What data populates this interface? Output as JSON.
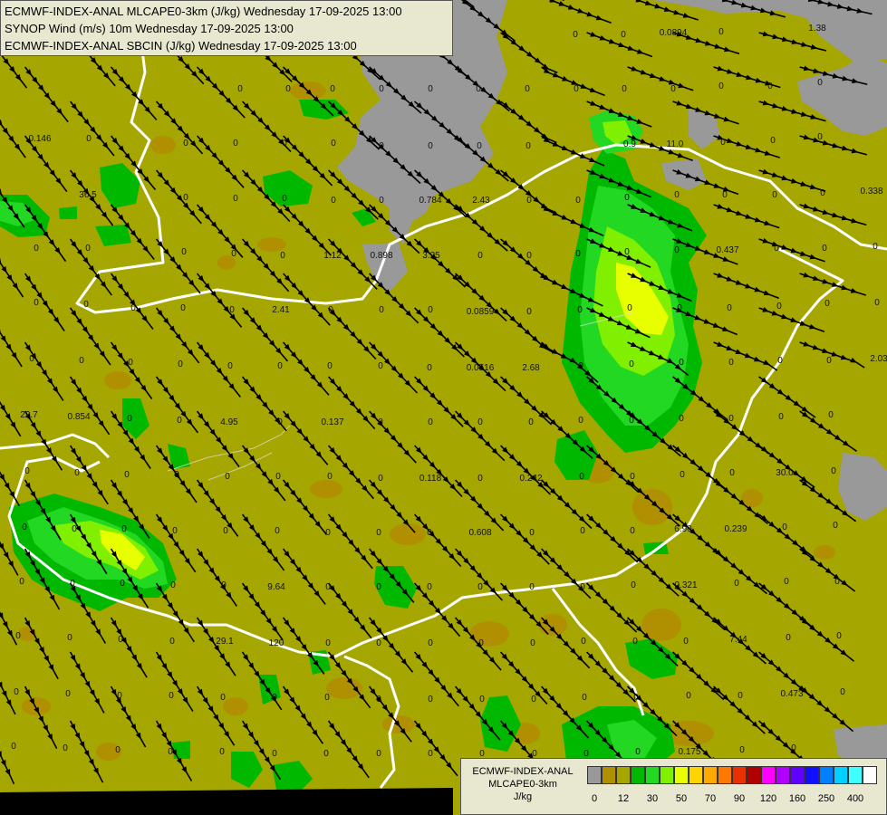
{
  "header": {
    "lines": [
      "ECMWF-INDEX-ANAL MLCAPE0-3km (J/kg) Wednesday 17-09-2025 13:00",
      "SYNOP Wind (m/s) 10m Wednesday 17-09-2025 13:00",
      "ECMWF-INDEX-ANAL SBCIN (J/kg) Wednesday 17-09-2025 13:00"
    ]
  },
  "legend": {
    "name_lines": [
      "ECMWF-INDEX-ANAL",
      "MLCAPE0-3km",
      "J/kg"
    ],
    "colors": [
      "#999999",
      "#b09000",
      "#a6a600",
      "#00b800",
      "#22d822",
      "#80f000",
      "#e8ff00",
      "#ffd400",
      "#ffa800",
      "#ff7800",
      "#e83000",
      "#b00000",
      "#ff00ff",
      "#b000ff",
      "#6000ff",
      "#1010ff",
      "#0080ff",
      "#00d0ff",
      "#40ffff",
      "#ffffff"
    ],
    "ticks": [
      "0",
      "12",
      "30",
      "50",
      "70",
      "90",
      "120",
      "160",
      "250",
      "400"
    ],
    "tick_colors_index": [
      1,
      3,
      5,
      7,
      9,
      11,
      13,
      15,
      17,
      19
    ]
  },
  "map_values": [
    {
      "t": "0",
      "a": [
        163,
        37
      ]
    },
    {
      "t": "0",
      "a": [
        240,
        37
      ]
    },
    {
      "t": "0",
      "a": [
        318,
        37
      ]
    },
    {
      "t": "0",
      "a": [
        398,
        37
      ]
    },
    {
      "t": "0",
      "a": [
        475,
        37
      ]
    },
    {
      "t": "0",
      "a": [
        635,
        37
      ]
    },
    {
      "t": "0",
      "a": [
        688,
        37
      ]
    },
    {
      "t": "0.0894",
      "a": [
        743,
        35
      ]
    },
    {
      "t": "0",
      "a": [
        796,
        34
      ]
    },
    {
      "t": "1.38",
      "a": [
        902,
        30
      ]
    },
    {
      "t": "0",
      "a": [
        265,
        97
      ]
    },
    {
      "t": "0",
      "a": [
        318,
        97
      ]
    },
    {
      "t": "0",
      "a": [
        367,
        97
      ]
    },
    {
      "t": "0",
      "a": [
        421,
        97
      ]
    },
    {
      "t": "0",
      "a": [
        475,
        97
      ]
    },
    {
      "t": "0",
      "a": [
        528,
        97
      ]
    },
    {
      "t": "0",
      "a": [
        582,
        97
      ]
    },
    {
      "t": "0",
      "a": [
        636,
        97
      ]
    },
    {
      "t": "0",
      "a": [
        689,
        97
      ]
    },
    {
      "t": "0",
      "a": [
        743,
        97
      ]
    },
    {
      "t": "0",
      "a": [
        796,
        94
      ]
    },
    {
      "t": "0",
      "a": [
        850,
        94
      ]
    },
    {
      "t": "0",
      "a": [
        905,
        90
      ]
    },
    {
      "t": "0.146",
      "a": [
        44,
        152
      ]
    },
    {
      "t": "0",
      "a": [
        98,
        152
      ]
    },
    {
      "t": "0",
      "a": [
        205,
        157
      ]
    },
    {
      "t": "0",
      "a": [
        260,
        157
      ]
    },
    {
      "t": "0",
      "a": [
        314,
        157
      ]
    },
    {
      "t": "0",
      "a": [
        368,
        157
      ]
    },
    {
      "t": "0",
      "a": [
        421,
        160
      ]
    },
    {
      "t": "0",
      "a": [
        475,
        160
      ]
    },
    {
      "t": "0",
      "a": [
        529,
        160
      ]
    },
    {
      "t": "0",
      "a": [
        583,
        160
      ]
    },
    {
      "t": "0.9",
      "a": [
        695,
        158
      ]
    },
    {
      "t": "11.0",
      "a": [
        745,
        158
      ]
    },
    {
      "t": "0",
      "a": [
        798,
        156
      ]
    },
    {
      "t": "0",
      "a": [
        853,
        154
      ]
    },
    {
      "t": "0",
      "a": [
        905,
        150
      ]
    },
    {
      "t": "36.5",
      "a": [
        97,
        214
      ]
    },
    {
      "t": "0",
      "a": [
        205,
        217
      ]
    },
    {
      "t": "0",
      "a": [
        260,
        218
      ]
    },
    {
      "t": "0",
      "a": [
        314,
        218
      ]
    },
    {
      "t": "0",
      "a": [
        368,
        220
      ]
    },
    {
      "t": "0",
      "a": [
        421,
        220
      ]
    },
    {
      "t": "0.784",
      "a": [
        475,
        220
      ]
    },
    {
      "t": "2.43",
      "a": [
        531,
        220
      ]
    },
    {
      "t": "0",
      "a": [
        584,
        220
      ]
    },
    {
      "t": "0",
      "a": [
        638,
        220
      ]
    },
    {
      "t": "0",
      "a": [
        692,
        217
      ]
    },
    {
      "t": "0",
      "a": [
        747,
        214
      ]
    },
    {
      "t": "0",
      "a": [
        800,
        214
      ]
    },
    {
      "t": "0",
      "a": [
        855,
        214
      ]
    },
    {
      "t": "0",
      "a": [
        908,
        212
      ]
    },
    {
      "t": "0.338",
      "a": [
        962,
        210
      ]
    },
    {
      "t": "0",
      "a": [
        40,
        273
      ]
    },
    {
      "t": "0",
      "a": [
        97,
        273
      ]
    },
    {
      "t": "0",
      "a": [
        203,
        277
      ]
    },
    {
      "t": "0",
      "a": [
        258,
        279
      ]
    },
    {
      "t": "0",
      "a": [
        312,
        281
      ]
    },
    {
      "t": "1.12",
      "a": [
        367,
        281
      ]
    },
    {
      "t": "0.898",
      "a": [
        421,
        281
      ]
    },
    {
      "t": "3.25",
      "a": [
        476,
        281
      ]
    },
    {
      "t": "0",
      "a": [
        530,
        281
      ]
    },
    {
      "t": "0",
      "a": [
        584,
        281
      ]
    },
    {
      "t": "0",
      "a": [
        638,
        279
      ]
    },
    {
      "t": "0",
      "a": [
        692,
        277
      ]
    },
    {
      "t": "0",
      "a": [
        747,
        275
      ]
    },
    {
      "t": "0.437",
      "a": [
        803,
        275
      ]
    },
    {
      "t": "0",
      "a": [
        857,
        273
      ]
    },
    {
      "t": "0",
      "a": [
        910,
        273
      ]
    },
    {
      "t": "0",
      "a": [
        966,
        271
      ]
    },
    {
      "t": "0",
      "a": [
        40,
        333
      ]
    },
    {
      "t": "0",
      "a": [
        95,
        335
      ]
    },
    {
      "t": "0",
      "a": [
        147,
        339
      ]
    },
    {
      "t": "0",
      "a": [
        202,
        339
      ]
    },
    {
      "t": "0",
      "a": [
        256,
        341
      ]
    },
    {
      "t": "2.41",
      "a": [
        310,
        341
      ]
    },
    {
      "t": "0",
      "a": [
        365,
        341
      ]
    },
    {
      "t": "0",
      "a": [
        421,
        341
      ]
    },
    {
      "t": "0",
      "a": [
        475,
        341
      ]
    },
    {
      "t": "0.0859",
      "a": [
        530,
        343
      ]
    },
    {
      "t": "0",
      "a": [
        584,
        343
      ]
    },
    {
      "t": "0",
      "a": [
        640,
        341
      ]
    },
    {
      "t": "0",
      "a": [
        695,
        339
      ]
    },
    {
      "t": "0",
      "a": [
        750,
        339
      ]
    },
    {
      "t": "0",
      "a": [
        805,
        339
      ]
    },
    {
      "t": "0",
      "a": [
        860,
        337
      ]
    },
    {
      "t": "0",
      "a": [
        913,
        334
      ]
    },
    {
      "t": "0",
      "a": [
        968,
        333
      ]
    },
    {
      "t": "0",
      "a": [
        35,
        395
      ]
    },
    {
      "t": "0",
      "a": [
        90,
        397
      ]
    },
    {
      "t": "0",
      "a": [
        144,
        399
      ]
    },
    {
      "t": "0",
      "a": [
        199,
        401
      ]
    },
    {
      "t": "0",
      "a": [
        254,
        403
      ]
    },
    {
      "t": "0",
      "a": [
        309,
        403
      ]
    },
    {
      "t": "0",
      "a": [
        364,
        403
      ]
    },
    {
      "t": "0",
      "a": [
        420,
        403
      ]
    },
    {
      "t": "0",
      "a": [
        474,
        405
      ]
    },
    {
      "t": "0.0516",
      "a": [
        530,
        405
      ]
    },
    {
      "t": "2.68",
      "a": [
        586,
        405
      ]
    },
    {
      "t": "0",
      "a": [
        641,
        403
      ]
    },
    {
      "t": "0",
      "a": [
        697,
        401
      ]
    },
    {
      "t": "0",
      "a": [
        752,
        399
      ]
    },
    {
      "t": "0",
      "a": [
        807,
        399
      ]
    },
    {
      "t": "0",
      "a": [
        861,
        397
      ]
    },
    {
      "t": "0",
      "a": [
        915,
        397
      ]
    },
    {
      "t": "2.03",
      "a": [
        970,
        395
      ]
    },
    {
      "t": "22.7",
      "a": [
        32,
        457
      ]
    },
    {
      "t": "0.854",
      "a": [
        87,
        459
      ]
    },
    {
      "t": "0",
      "a": [
        143,
        461
      ]
    },
    {
      "t": "0",
      "a": [
        198,
        463
      ]
    },
    {
      "t": "4.95",
      "a": [
        253,
        465
      ]
    },
    {
      "t": "0",
      "a": [
        309,
        465
      ]
    },
    {
      "t": "0.137",
      "a": [
        367,
        465
      ]
    },
    {
      "t": "0",
      "a": [
        420,
        465
      ]
    },
    {
      "t": "0",
      "a": [
        475,
        465
      ]
    },
    {
      "t": "0",
      "a": [
        530,
        465
      ]
    },
    {
      "t": "0",
      "a": [
        586,
        465
      ]
    },
    {
      "t": "0",
      "a": [
        641,
        463
      ]
    },
    {
      "t": "0",
      "a": [
        697,
        463
      ]
    },
    {
      "t": "0",
      "a": [
        752,
        461
      ]
    },
    {
      "t": "0",
      "a": [
        807,
        461
      ]
    },
    {
      "t": "0",
      "a": [
        862,
        459
      ]
    },
    {
      "t": "0",
      "a": [
        917,
        457
      ]
    },
    {
      "t": "0",
      "a": [
        30,
        519
      ]
    },
    {
      "t": "0",
      "a": [
        85,
        521
      ]
    },
    {
      "t": "0",
      "a": [
        140,
        523
      ]
    },
    {
      "t": "0",
      "a": [
        195,
        523
      ]
    },
    {
      "t": "0",
      "a": [
        251,
        525
      ]
    },
    {
      "t": "0",
      "a": [
        307,
        525
      ]
    },
    {
      "t": "0",
      "a": [
        364,
        525
      ]
    },
    {
      "t": "0",
      "a": [
        420,
        527
      ]
    },
    {
      "t": "0.118",
      "a": [
        475,
        527
      ]
    },
    {
      "t": "0",
      "a": [
        530,
        527
      ]
    },
    {
      "t": "0.242",
      "a": [
        586,
        527
      ]
    },
    {
      "t": "0",
      "a": [
        642,
        525
      ]
    },
    {
      "t": "0",
      "a": [
        698,
        525
      ]
    },
    {
      "t": "0",
      "a": [
        753,
        523
      ]
    },
    {
      "t": "0",
      "a": [
        808,
        521
      ]
    },
    {
      "t": "30.0",
      "a": [
        866,
        521
      ]
    },
    {
      "t": "0",
      "a": [
        920,
        519
      ]
    },
    {
      "t": "0",
      "a": [
        27,
        581
      ]
    },
    {
      "t": "0",
      "a": [
        82,
        583
      ]
    },
    {
      "t": "0",
      "a": [
        137,
        583
      ]
    },
    {
      "t": "0",
      "a": [
        193,
        585
      ]
    },
    {
      "t": "0",
      "a": [
        249,
        585
      ]
    },
    {
      "t": "0",
      "a": [
        306,
        585
      ]
    },
    {
      "t": "0",
      "a": [
        362,
        587
      ]
    },
    {
      "t": "0",
      "a": [
        418,
        587
      ]
    },
    {
      "t": "0",
      "a": [
        474,
        587
      ]
    },
    {
      "t": "0.608",
      "a": [
        530,
        587
      ]
    },
    {
      "t": "0",
      "a": [
        587,
        587
      ]
    },
    {
      "t": "0",
      "a": [
        643,
        585
      ]
    },
    {
      "t": "0",
      "a": [
        698,
        585
      ]
    },
    {
      "t": "6.90",
      "a": [
        754,
        583
      ]
    },
    {
      "t": "0.239",
      "a": [
        812,
        583
      ]
    },
    {
      "t": "0",
      "a": [
        866,
        581
      ]
    },
    {
      "t": "0",
      "a": [
        922,
        579
      ]
    },
    {
      "t": "0",
      "a": [
        24,
        641
      ]
    },
    {
      "t": "0",
      "a": [
        80,
        643
      ]
    },
    {
      "t": "0",
      "a": [
        135,
        643
      ]
    },
    {
      "t": "0",
      "a": [
        191,
        645
      ]
    },
    {
      "t": "0",
      "a": [
        247,
        645
      ]
    },
    {
      "t": "9.64",
      "a": [
        305,
        647
      ]
    },
    {
      "t": "0",
      "a": [
        362,
        647
      ]
    },
    {
      "t": "0",
      "a": [
        418,
        647
      ]
    },
    {
      "t": "0",
      "a": [
        474,
        647
      ]
    },
    {
      "t": "0",
      "a": [
        530,
        647
      ]
    },
    {
      "t": "0",
      "a": [
        587,
        647
      ]
    },
    {
      "t": "0",
      "a": [
        643,
        647
      ]
    },
    {
      "t": "0",
      "a": [
        699,
        645
      ]
    },
    {
      "t": "0.321",
      "a": [
        757,
        645
      ]
    },
    {
      "t": "0",
      "a": [
        813,
        643
      ]
    },
    {
      "t": "0",
      "a": [
        868,
        641
      ]
    },
    {
      "t": "0",
      "a": [
        924,
        641
      ]
    },
    {
      "t": "0",
      "a": [
        20,
        701
      ]
    },
    {
      "t": "0",
      "a": [
        77,
        703
      ]
    },
    {
      "t": "0",
      "a": [
        133,
        705
      ]
    },
    {
      "t": "0",
      "a": [
        190,
        707
      ]
    },
    {
      "t": "29.1",
      "a": [
        248,
        707
      ]
    },
    {
      "t": "120",
      "a": [
        305,
        709
      ]
    },
    {
      "t": "0",
      "a": [
        362,
        709
      ]
    },
    {
      "t": "0",
      "a": [
        418,
        709
      ]
    },
    {
      "t": "0",
      "a": [
        475,
        709
      ]
    },
    {
      "t": "0",
      "a": [
        531,
        709
      ]
    },
    {
      "t": "0",
      "a": [
        588,
        709
      ]
    },
    {
      "t": "0",
      "a": [
        644,
        707
      ]
    },
    {
      "t": "0",
      "a": [
        701,
        707
      ]
    },
    {
      "t": "0",
      "a": [
        757,
        707
      ]
    },
    {
      "t": "7.44",
      "a": [
        815,
        705
      ]
    },
    {
      "t": "0",
      "a": [
        870,
        703
      ]
    },
    {
      "t": "0",
      "a": [
        926,
        701
      ]
    },
    {
      "t": "0",
      "a": [
        18,
        763
      ]
    },
    {
      "t": "0",
      "a": [
        75,
        765
      ]
    },
    {
      "t": "0",
      "a": [
        132,
        767
      ]
    },
    {
      "t": "0",
      "a": [
        189,
        767
      ]
    },
    {
      "t": "0",
      "a": [
        246,
        769
      ]
    },
    {
      "t": "0",
      "a": [
        303,
        769
      ]
    },
    {
      "t": "0",
      "a": [
        361,
        769
      ]
    },
    {
      "t": "0",
      "a": [
        418,
        771
      ]
    },
    {
      "t": "0",
      "a": [
        475,
        771
      ]
    },
    {
      "t": "0",
      "a": [
        532,
        771
      ]
    },
    {
      "t": "0",
      "a": [
        589,
        771
      ]
    },
    {
      "t": "0",
      "a": [
        645,
        769
      ]
    },
    {
      "t": "0",
      "a": [
        702,
        769
      ]
    },
    {
      "t": "0",
      "a": [
        760,
        767
      ]
    },
    {
      "t": "0",
      "a": [
        817,
        767
      ]
    },
    {
      "t": "0.473",
      "a": [
        874,
        765
      ]
    },
    {
      "t": "0",
      "a": [
        930,
        763
      ]
    },
    {
      "t": "0",
      "a": [
        15,
        823
      ]
    },
    {
      "t": "0",
      "a": [
        72,
        825
      ]
    },
    {
      "t": "0",
      "a": [
        130,
        827
      ]
    },
    {
      "t": "0",
      "a": [
        188,
        829
      ]
    },
    {
      "t": "0",
      "a": [
        245,
        829
      ]
    },
    {
      "t": "0",
      "a": [
        303,
        831
      ]
    },
    {
      "t": "0",
      "a": [
        360,
        831
      ]
    },
    {
      "t": "0",
      "a": [
        418,
        831
      ]
    },
    {
      "t": "0",
      "a": [
        475,
        831
      ]
    },
    {
      "t": "0",
      "a": [
        532,
        831
      ]
    },
    {
      "t": "0",
      "a": [
        590,
        831
      ]
    },
    {
      "t": "0",
      "a": [
        647,
        831
      ]
    },
    {
      "t": "0",
      "a": [
        704,
        829
      ]
    },
    {
      "t": "0.175",
      "a": [
        761,
        829
      ]
    },
    {
      "t": "0",
      "a": [
        819,
        827
      ]
    },
    {
      "t": "0",
      "a": [
        876,
        825
      ]
    }
  ]
}
